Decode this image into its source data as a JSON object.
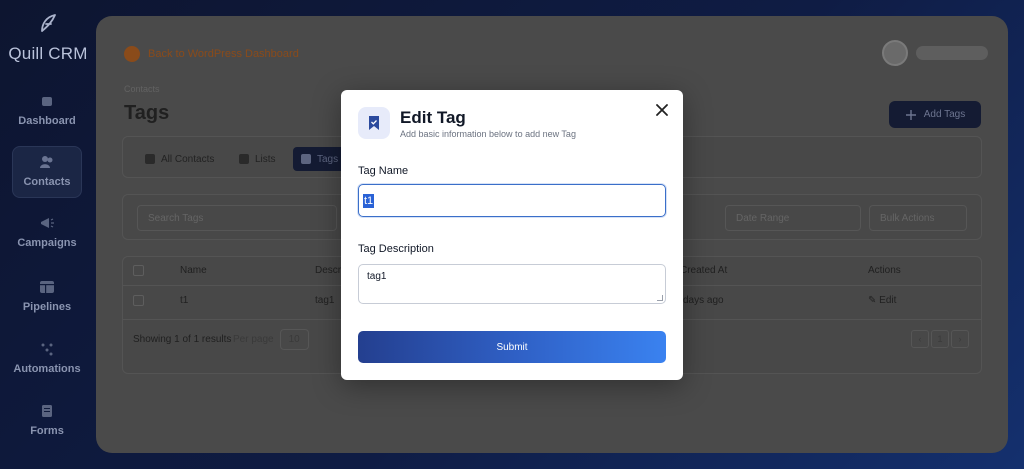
{
  "app": {
    "name": "Quill CRM"
  },
  "sidebar": {
    "items": [
      {
        "label": "Dashboard",
        "icon": "home-icon"
      },
      {
        "label": "Contacts",
        "icon": "users-icon",
        "active": true
      },
      {
        "label": "Campaigns",
        "icon": "megaphone-icon"
      },
      {
        "label": "Pipelines",
        "icon": "pipeline-icon"
      },
      {
        "label": "Automations",
        "icon": "automation-icon"
      },
      {
        "label": "Forms",
        "icon": "form-icon"
      }
    ]
  },
  "header": {
    "back_link": "Back to WordPress Dashboard"
  },
  "page": {
    "breadcrumb": "Contacts",
    "title": "Tags",
    "add_button": "Add Tags"
  },
  "tabs": [
    {
      "label": "All Contacts"
    },
    {
      "label": "Lists"
    },
    {
      "label": "Tags",
      "active": true
    }
  ],
  "filters": {
    "search_placeholder": "Search Tags",
    "date_range": "Date Range",
    "bulk_actions": "Bulk Actions"
  },
  "table": {
    "columns": [
      "Name",
      "Description",
      "Created At",
      "Actions"
    ],
    "col_name_visible": "Name",
    "col_desc_visible": "Descr",
    "col_created_visible": "Created At",
    "col_actions_visible": "Actions",
    "rows": [
      {
        "name": "t1",
        "description": "tag1",
        "created_at": "days ago",
        "action": "Edit"
      }
    ],
    "footer": {
      "showing": "Showing 1 of 1 results",
      "per_page_label": "Per page",
      "per_page_value": "10",
      "current_page": "1"
    }
  },
  "modal": {
    "title": "Edit Tag",
    "subtitle": "Add basic information below to add new Tag",
    "tag_name_label": "Tag Name",
    "tag_name_value": "t1",
    "tag_description_label": "Tag Description",
    "tag_description_value": "tag1",
    "submit_label": "Submit"
  },
  "colors": {
    "accent": "#2f5fc4",
    "modal_icon_bg": "#e7ebfa",
    "sidebar_bg": "#0f1a3a"
  }
}
